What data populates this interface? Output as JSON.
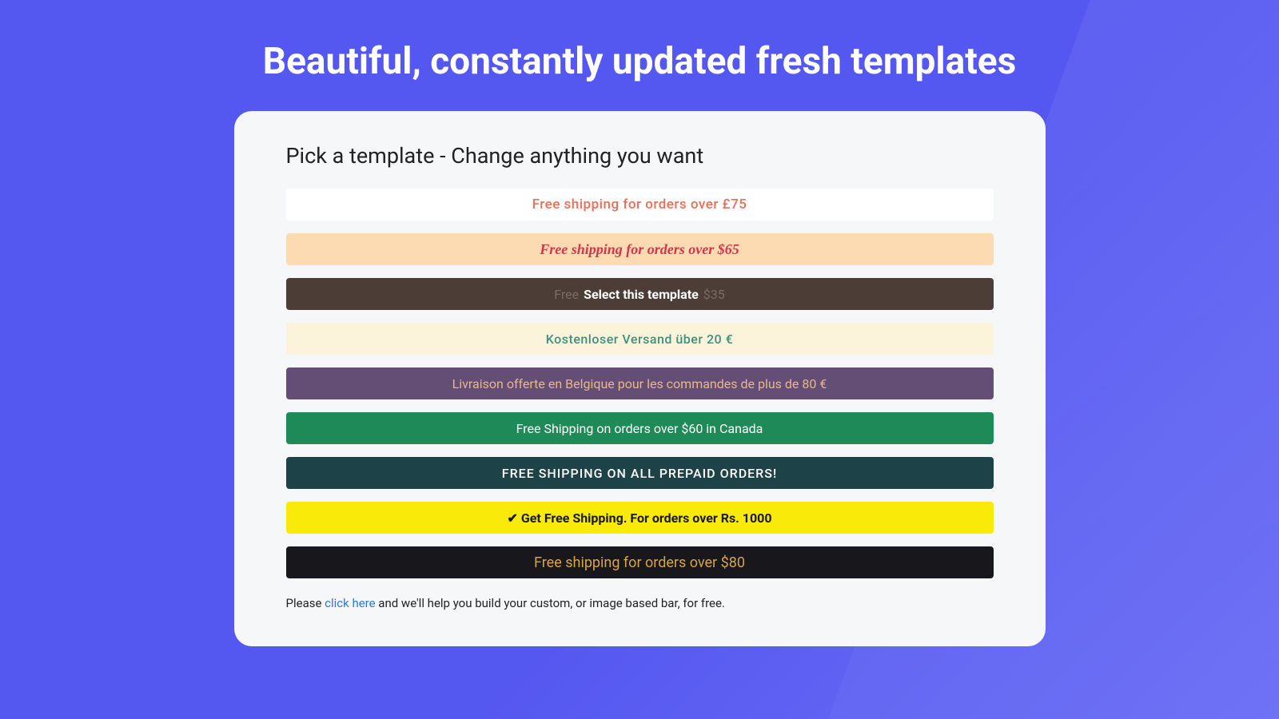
{
  "headline": "Beautiful, constantly updated fresh templates",
  "subhead": "Pick a template - Change anything you want",
  "bars": {
    "b0": "Free shipping for orders over £75",
    "b1": "Free shipping for orders over $65",
    "b2_pre": "Free ",
    "b2_cta": "Select this template",
    "b2_suf": "  $35",
    "b3": "Kostenloser Versand über 20 €",
    "b4": "Livraison offerte en Belgique pour les commandes de plus de 80 €",
    "b5": "Free Shipping on orders over $60 in Canada",
    "b6": "FREE SHIPPING ON ALL PREPAID ORDERS!",
    "b7": "✔ Get Free Shipping. For orders over Rs. 1000",
    "b8": "Free shipping for orders over $80"
  },
  "helper": {
    "pre": "Please ",
    "link": "click here",
    "suf": " and we'll help you build your custom, or image based bar, for free."
  }
}
